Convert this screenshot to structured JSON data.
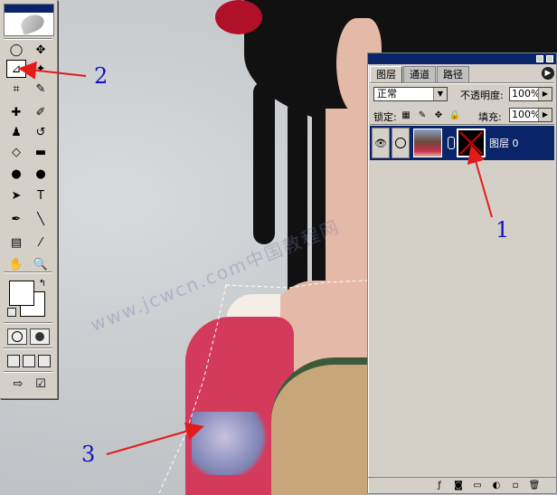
{
  "toolbox": {
    "tools": [
      {
        "name": "marquee-tool",
        "glyph": "◯"
      },
      {
        "name": "move-tool",
        "glyph": "✥"
      },
      {
        "name": "lasso-tool",
        "glyph": "⊿"
      },
      {
        "name": "magic-wand-tool",
        "glyph": "✦"
      },
      {
        "name": "crop-tool",
        "glyph": "⌗"
      },
      {
        "name": "slice-tool",
        "glyph": "✎"
      },
      {
        "name": "healing-brush-tool",
        "glyph": "✚"
      },
      {
        "name": "brush-tool",
        "glyph": "✐"
      },
      {
        "name": "clone-stamp-tool",
        "glyph": "♟"
      },
      {
        "name": "history-brush-tool",
        "glyph": "↺"
      },
      {
        "name": "eraser-tool",
        "glyph": "◇"
      },
      {
        "name": "gradient-tool",
        "glyph": "▬"
      },
      {
        "name": "blur-tool",
        "glyph": "●"
      },
      {
        "name": "dodge-tool",
        "glyph": "●"
      },
      {
        "name": "path-selection-tool",
        "glyph": "➤"
      },
      {
        "name": "type-tool",
        "glyph": "T"
      },
      {
        "name": "pen-tool",
        "glyph": "✒"
      },
      {
        "name": "line-tool",
        "glyph": "╲"
      },
      {
        "name": "notes-tool",
        "glyph": "▤"
      },
      {
        "name": "eyedropper-tool",
        "glyph": "⁄"
      },
      {
        "name": "hand-tool",
        "glyph": "✋"
      },
      {
        "name": "zoom-tool",
        "glyph": "🔍"
      }
    ]
  },
  "layers_panel": {
    "tabs": [
      "图层",
      "通道",
      "路径"
    ],
    "blend_mode": "正常",
    "opacity_label": "不透明度:",
    "opacity_value": "100%",
    "lock_label": "锁定:",
    "fill_label": "填充:",
    "fill_value": "100%",
    "layer_name": "图层 0",
    "menu_icon": "play-icon"
  },
  "annotations": [
    "1",
    "2",
    "3"
  ],
  "colors": {
    "annotation_blue": "#1212c8",
    "arrow_red": "#e41b1b",
    "panel_gray": "#d4d0c8",
    "title_navy": "#0a246a"
  }
}
